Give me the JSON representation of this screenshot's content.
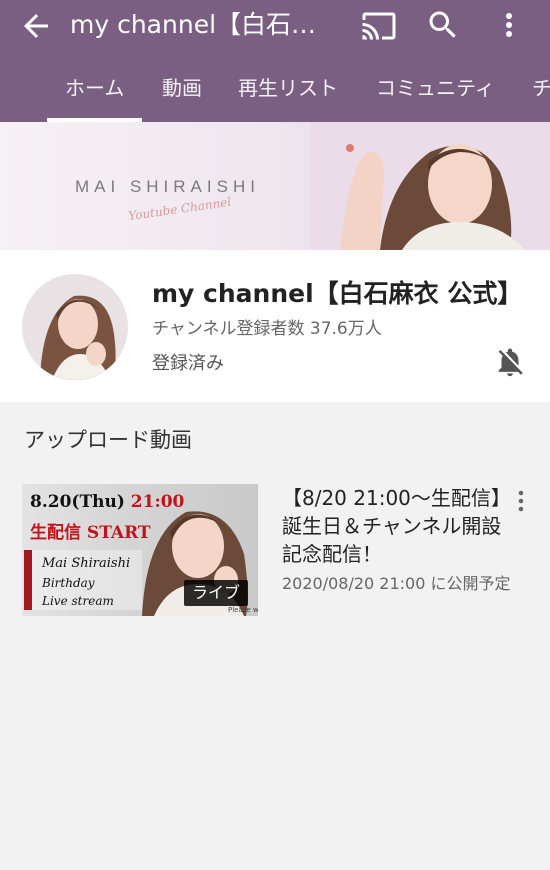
{
  "header": {
    "title": "my channel【白石…",
    "back_icon": "arrow-back-icon",
    "cast_icon": "cast-icon",
    "search_icon": "search-icon",
    "more_icon": "more-vert-icon",
    "background_color": "#7a5f82"
  },
  "tabs": [
    {
      "label": "ホーム",
      "active": true
    },
    {
      "label": "動画",
      "active": false
    },
    {
      "label": "再生リスト",
      "active": false
    },
    {
      "label": "コミュニティ",
      "active": false
    },
    {
      "label": "チ",
      "active": false
    }
  ],
  "banner": {
    "name_text": "MAI SHIRAISHI",
    "sub_text": "Youtube Channel"
  },
  "channel": {
    "name": "my channel【白石麻衣 公式】",
    "subscribers": "チャンネル登録者数 37.6万人",
    "subscribed_label": "登録済み",
    "bell_icon": "notifications-off-icon"
  },
  "uploads": {
    "section_title": "アップロード動画",
    "videos": [
      {
        "thumbnail": {
          "date_text": "8.20(Thu) ",
          "time_text": "21:00",
          "line2": "生配信 START",
          "line3": "Mai Shiraishi",
          "line4": "Birthday",
          "line5": "Live stream",
          "footnote": "Please wait..."
        },
        "badge": "ライブ",
        "title": "【8/20 21:00〜生配信】誕生日＆チャンネル開設記念配信！",
        "meta": "2020/08/20 21:00 に公開予定",
        "more_icon": "more-vert-icon"
      }
    ]
  }
}
